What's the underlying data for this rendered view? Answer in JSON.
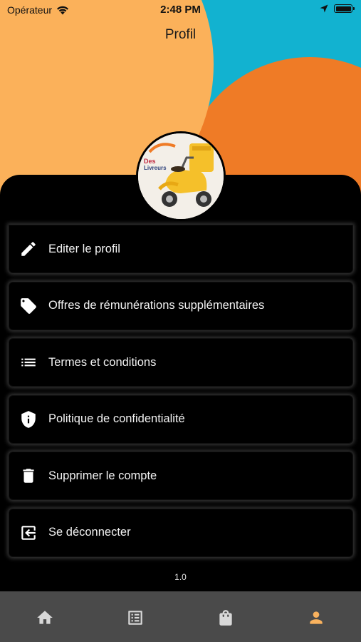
{
  "status_bar": {
    "carrier": "Opérateur",
    "time": "2:48 PM"
  },
  "header": {
    "title": "Profil"
  },
  "avatar": {
    "logo_text_line1": "Des",
    "logo_text_line2": "Livreurs"
  },
  "menu": {
    "items": [
      {
        "label": "Editer le profil",
        "icon": "pencil-icon"
      },
      {
        "label": "Offres de rémunérations supplémentaires",
        "icon": "tag-icon"
      },
      {
        "label": "Termes et conditions",
        "icon": "list-icon"
      },
      {
        "label": "Politique de confidentialité",
        "icon": "shield-info-icon"
      },
      {
        "label": "Supprimer le compte",
        "icon": "trash-icon"
      },
      {
        "label": "Se déconnecter",
        "icon": "logout-icon"
      }
    ]
  },
  "version": "1.0",
  "tab_bar": {
    "tabs": [
      {
        "icon": "home-icon",
        "active": false
      },
      {
        "icon": "list-alt-icon",
        "active": false
      },
      {
        "icon": "shopping-bag-icon",
        "active": false
      },
      {
        "icon": "person-icon",
        "active": true
      }
    ],
    "active_color": "#f9b25e",
    "inactive_color": "#d8d8d8"
  },
  "colors": {
    "blue": "#12b2d0",
    "orange": "#ef7b26",
    "yellow": "#fbb15a"
  }
}
